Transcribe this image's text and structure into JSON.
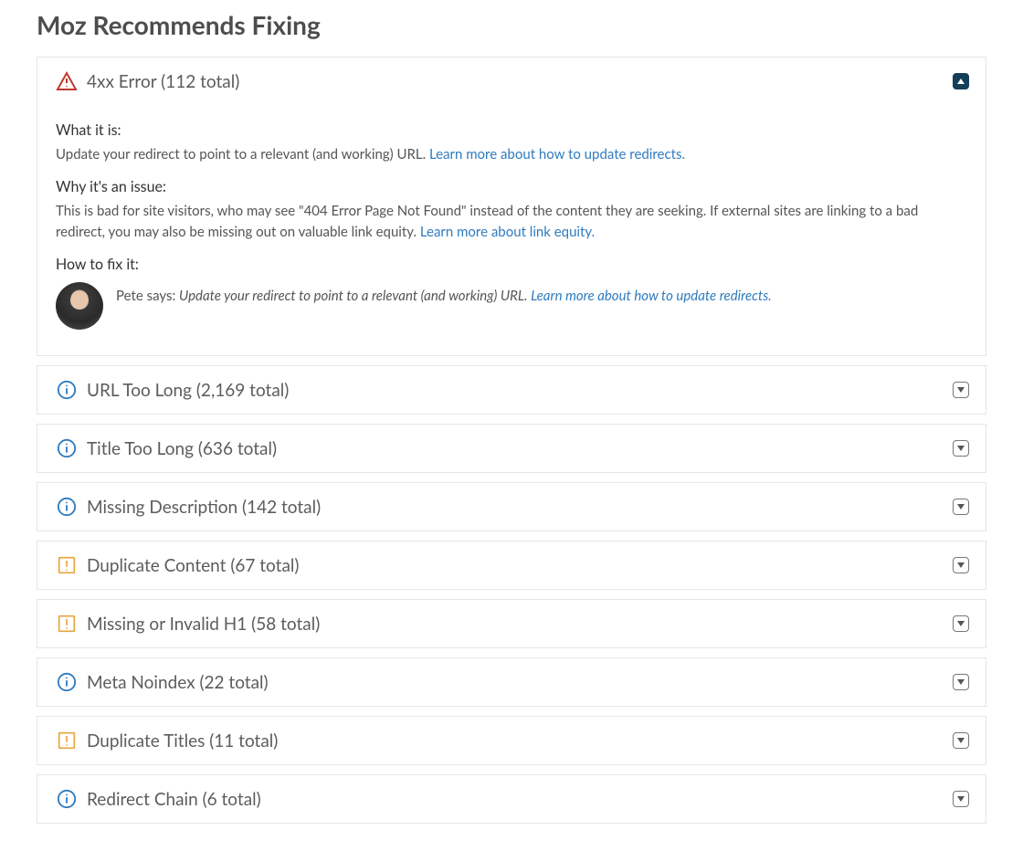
{
  "page": {
    "title": "Moz Recommends Fixing"
  },
  "issues": [
    {
      "icon": "alert-triangle",
      "severity": "critical",
      "title": "4xx Error (112 total)",
      "expanded": true,
      "what_label": "What it is:",
      "what_text": "Update your redirect to point to a relevant (and working) URL. ",
      "what_link": "Learn more about how to update redirects.",
      "why_label": "Why it's an issue:",
      "why_text": "This is bad for site visitors, who may see \"404 Error Page Not Found\" instead of the content they are seeking. If external sites are linking to a bad redirect, you may also be missing out on valuable link equity. ",
      "why_link": "Learn more about link equity.",
      "fix_label": "How to fix it:",
      "fix_lead": "Pete says: ",
      "fix_text": "Update your redirect to point to a relevant (and working) URL. ",
      "fix_link": "Learn more about how to update redirects."
    },
    {
      "icon": "info-circle",
      "severity": "info",
      "title": "URL Too Long (2,169 total)",
      "expanded": false
    },
    {
      "icon": "info-circle",
      "severity": "info",
      "title": "Title Too Long (636 total)",
      "expanded": false
    },
    {
      "icon": "info-circle",
      "severity": "info",
      "title": "Missing Description (142 total)",
      "expanded": false
    },
    {
      "icon": "alert-square",
      "severity": "warning",
      "title": "Duplicate Content (67 total)",
      "expanded": false
    },
    {
      "icon": "alert-square",
      "severity": "warning",
      "title": "Missing or Invalid H1 (58 total)",
      "expanded": false
    },
    {
      "icon": "info-circle",
      "severity": "info",
      "title": "Meta Noindex (22 total)",
      "expanded": false
    },
    {
      "icon": "alert-square",
      "severity": "warning",
      "title": "Duplicate Titles (11 total)",
      "expanded": false
    },
    {
      "icon": "info-circle",
      "severity": "info",
      "title": "Redirect Chain (6 total)",
      "expanded": false
    }
  ],
  "colors": {
    "critical": "#c0392b",
    "warning": "#e8a33d",
    "info": "#2f7bbf"
  }
}
